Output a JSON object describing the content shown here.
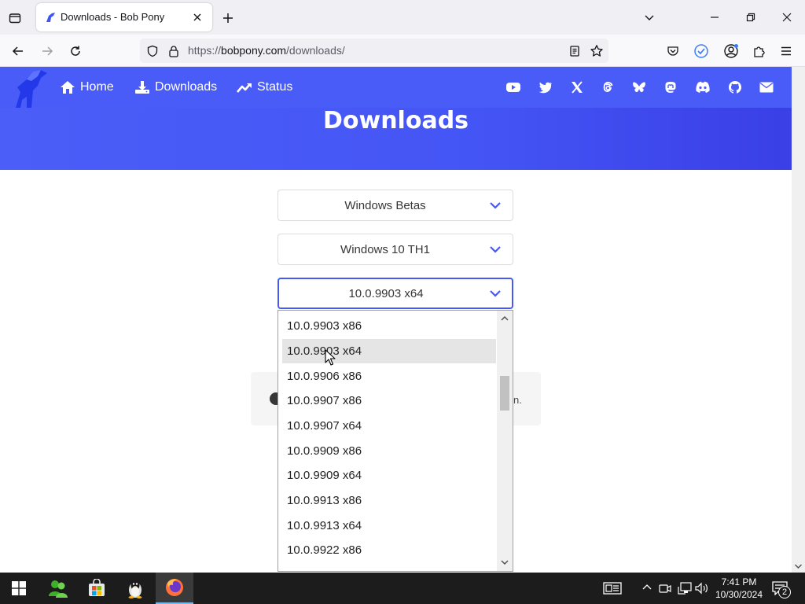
{
  "browser": {
    "tab_title": "Downloads - Bob Pony",
    "url_scheme": "https://",
    "url_host": "bobpony.com",
    "url_path": "/downloads/"
  },
  "site": {
    "nav": [
      {
        "label": "Home",
        "icon": "home-icon"
      },
      {
        "label": "Downloads",
        "icon": "download-icon"
      },
      {
        "label": "Status",
        "icon": "trending-up-icon"
      }
    ],
    "social_icons": [
      "youtube-icon",
      "twitter-icon",
      "x-icon",
      "threads-icon",
      "bluesky-icon",
      "mastodon-icon",
      "discord-icon",
      "github-icon",
      "mail-icon"
    ],
    "heading": "Downloads",
    "colors": {
      "accent": "#4a5cf7",
      "focus": "#4659f4"
    }
  },
  "selects": {
    "category": "Windows Betas",
    "product": "Windows 10 TH1",
    "build": "10.0.9903 x64"
  },
  "info_card": {
    "visible_text_fragment": "n."
  },
  "dropdown": {
    "options": [
      "10.0.9903 x86",
      "10.0.9903 x64",
      "10.0.9906 x86",
      "10.0.9907 x86",
      "10.0.9907 x64",
      "10.0.9909 x86",
      "10.0.9909 x64",
      "10.0.9913 x86",
      "10.0.9913 x64",
      "10.0.9922 x86"
    ],
    "hovered": "10.0.9903 x64"
  },
  "taskbar": {
    "time": "7:41 PM",
    "date": "10/30/2024",
    "notification_count": "2"
  }
}
